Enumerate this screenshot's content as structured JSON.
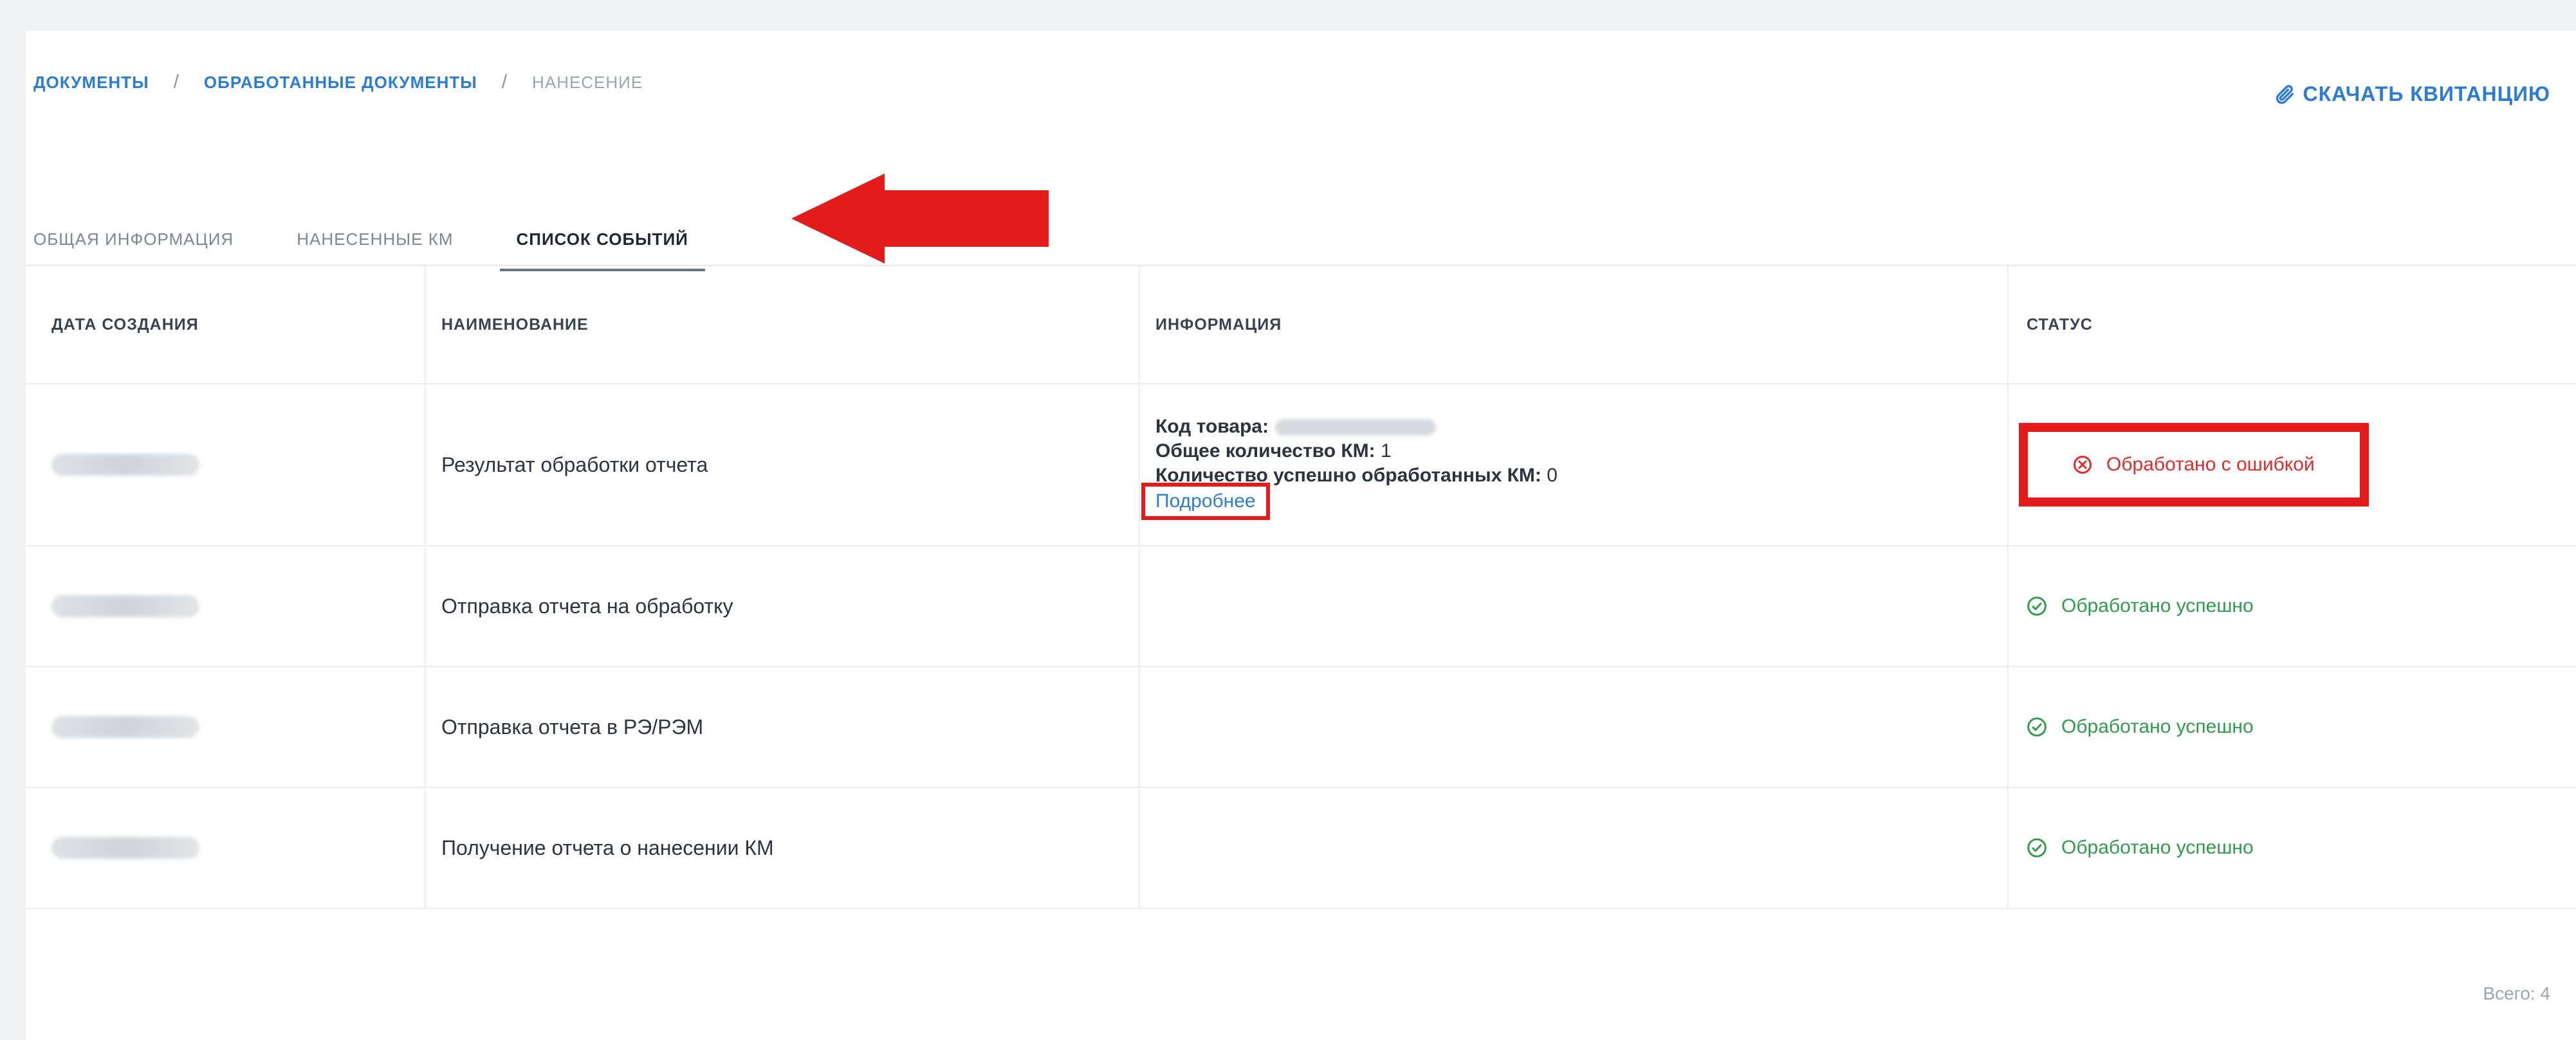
{
  "breadcrumb": {
    "items": [
      "ДОКУМЕНТЫ",
      "ОБРАБОТАННЫЕ ДОКУМЕНТЫ",
      "НАНЕСЕНИЕ"
    ],
    "separator": "/"
  },
  "download_link": "СКАЧАТЬ КВИТАНЦИЮ",
  "tabs": [
    "ОБЩАЯ ИНФОРМАЦИЯ",
    "НАНЕСЕННЫЕ КМ",
    "СПИСОК СОБЫТИЙ"
  ],
  "table": {
    "columns": [
      "ДАТА СОЗДАНИЯ",
      "НАИМЕНОВАНИЕ",
      "ИНФОРМАЦИЯ",
      "СТАТУС"
    ],
    "rows": [
      {
        "name": "Результат обработки отчета",
        "info": {
          "product_code_label": "Код товара:",
          "total_label": "Общее количество КМ:",
          "total_value": " 1",
          "success_label": "Количество успешно обработанных КМ:",
          "success_value": " 0",
          "more_link": "Подробнее"
        },
        "status": "Обработано с ошибкой"
      },
      {
        "name": "Отправка отчета на обработку",
        "status": "Обработано успешно"
      },
      {
        "name": "Отправка отчета в РЭ/РЭМ",
        "status": "Обработано успешно"
      },
      {
        "name": "Получение отчета о нанесении КМ",
        "status": "Обработано успешно"
      }
    ]
  },
  "footer": {
    "total": "Всего: 4"
  },
  "colors": {
    "accent": "#2c7bd6",
    "error": "#e12b2b",
    "success": "#2f9b4b",
    "annotation": "#e31b1b"
  },
  "icons": {
    "download": "paperclip-icon",
    "error_status": "error-circle-icon",
    "success_status": "check-circle-icon",
    "annotation_arrow": "arrow-left-icon"
  }
}
